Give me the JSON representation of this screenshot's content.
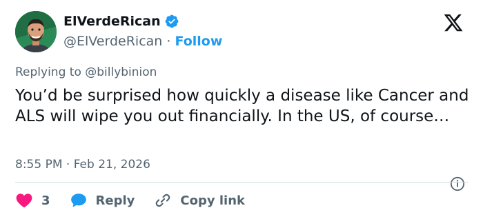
{
  "author": {
    "name": "ElVerdeRican",
    "handle": "@ElVerdeRican",
    "separator": "·",
    "follow_label": "Follow"
  },
  "reply_context": "Replying to @billybinion",
  "tweet": {
    "text": "You’d be surprised how quickly a disease like Cancer and ALS will wipe you out financially. In the US, of course…",
    "timestamp": "8:55 PM · Feb 21, 2026"
  },
  "actions": {
    "like_count": "3",
    "reply_label": "Reply",
    "copy_link_label": "Copy link"
  },
  "colors": {
    "like": "#f91880",
    "reply": "#1d9bf0",
    "verified": "#1d9bf0",
    "link": "#1d9bf0"
  },
  "icons": [
    "verified-badge-icon",
    "x-logo-icon",
    "info-icon",
    "heart-icon",
    "reply-bubble-icon",
    "link-icon"
  ]
}
